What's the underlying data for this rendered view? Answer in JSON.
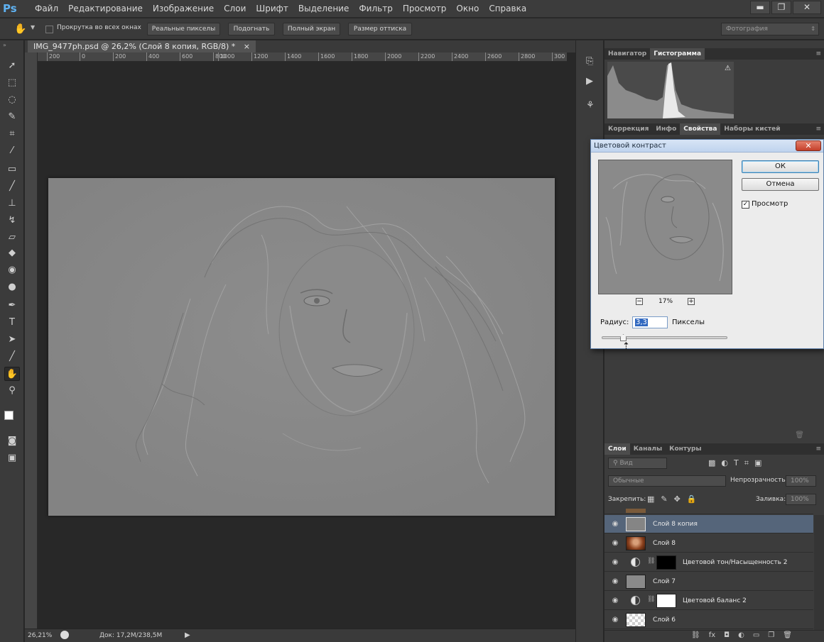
{
  "app": {
    "logo": "Ps"
  },
  "menu": [
    "Файл",
    "Редактирование",
    "Изображение",
    "Слои",
    "Шрифт",
    "Выделение",
    "Фильтр",
    "Просмотр",
    "Окно",
    "Справка"
  ],
  "window_controls": {
    "minimize": "▬",
    "restore": "❐",
    "close": "✕"
  },
  "options_bar": {
    "scroll_all_label": "Прокрутка во всех окнах",
    "actual_pixels": "Реальные пикселы",
    "fit_screen": "Подогнать",
    "full_screen": "Полный экран",
    "print_size": "Размер оттиска",
    "workspace": "Фотография"
  },
  "document": {
    "tab_title": "IMG_9477ph.psd @ 26,2% (Слой 8 копия, RGB/8) *",
    "tab_close": "×",
    "ruler_ticks": [
      "200",
      "0",
      "200",
      "400",
      "600",
      "800",
      "1000",
      "1200",
      "1400",
      "1600",
      "1800",
      "2000",
      "2200",
      "2400",
      "2600",
      "2800",
      "300"
    ],
    "zoom": "26,21%",
    "doc_info": "Док: 17,2M/238,5M"
  },
  "panels": {
    "top_tabs": [
      "Навигатор",
      "Гистограмма"
    ],
    "mid_tabs": [
      "Коррекция",
      "Инфо",
      "Свойства",
      "Наборы кистей"
    ],
    "layers_tabs": [
      "Слои",
      "Каналы",
      "Контуры"
    ],
    "filter_kind": "Вид",
    "blend_mode": "Обычные",
    "opacity_label": "Непрозрачность:",
    "opacity_value": "100%",
    "lock_label": "Закрепить:",
    "fill_label": "Заливка:",
    "fill_value": "100%"
  },
  "layers": [
    {
      "name": "Слой 8 копия",
      "type": "pixel",
      "selected": true
    },
    {
      "name": "Слой 8",
      "type": "photo",
      "selected": false
    },
    {
      "name": "Цветовой тон/Насыщенность 2",
      "type": "adjustment",
      "mask": "black",
      "selected": false
    },
    {
      "name": "Слой 7",
      "type": "pixel",
      "selected": false
    },
    {
      "name": "Цветовой баланс 2",
      "type": "adjustment",
      "mask": "white",
      "selected": false
    },
    {
      "name": "Слой 6",
      "type": "transparent",
      "selected": false
    }
  ],
  "dialog": {
    "title": "Цветовой контраст",
    "close": "✕",
    "ok": "ОК",
    "cancel": "Отмена",
    "preview_label": "Просмотр",
    "preview_checked": true,
    "zoom_minus": "−",
    "zoom_plus": "+",
    "zoom_value": "17%",
    "radius_label": "Радиус:",
    "radius_value": "3,3",
    "radius_unit": "Пикселы"
  },
  "colors": {
    "accent": "#5fb2f2",
    "selected_layer": "#55657a",
    "canvas": "#858585"
  }
}
